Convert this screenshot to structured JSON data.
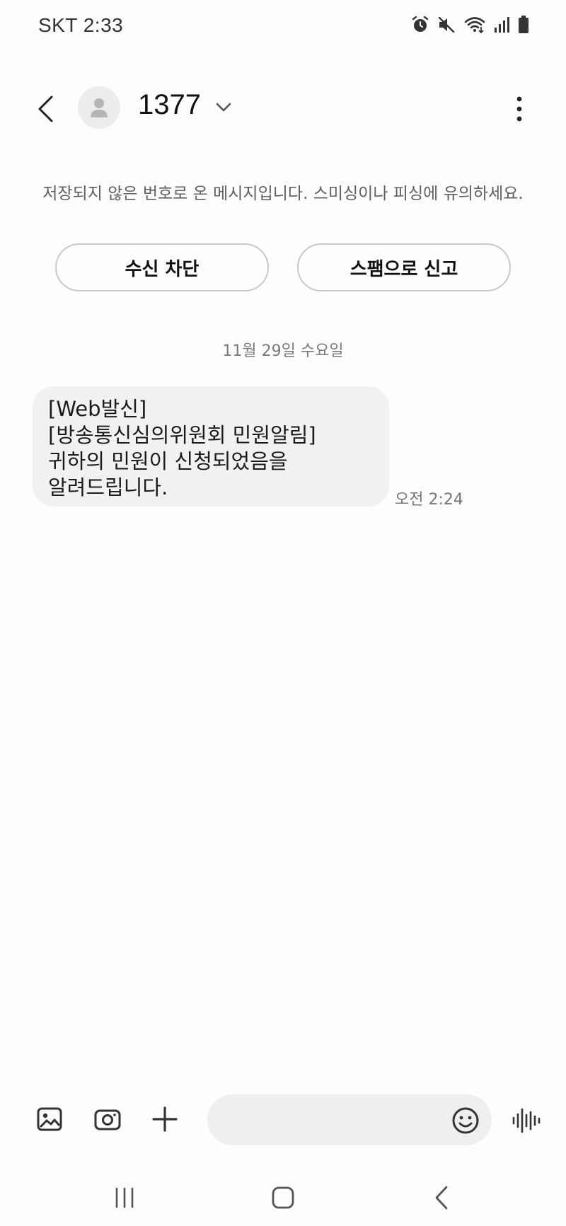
{
  "status_bar": {
    "carrier_time": "SKT 2:33",
    "icons": [
      "alarm-icon",
      "mute-icon",
      "wifi-icon",
      "signal-icon",
      "battery-icon"
    ]
  },
  "header": {
    "contact": "1377",
    "back_icon": "back-arrow-icon",
    "avatar_icon": "person-icon",
    "dropdown_icon": "chevron-down-icon",
    "menu_icon": "more-vertical-icon"
  },
  "warning": {
    "text": "저장되지 않은 번호로 온 메시지입니다. 스미싱이나 피싱에 유의하세요.",
    "block_label": "수신 차단",
    "spam_label": "스팸으로 신고"
  },
  "conversation": {
    "date": "11월 29일 수요일",
    "messages": [
      {
        "lines": [
          "[Web발신]",
          "[방송통신심의위원회 민원알림]",
          "귀하의 민원이 신청되었음을",
          "알려드립니다."
        ],
        "time": "오전 2:24"
      }
    ]
  },
  "composer": {
    "gallery_icon": "gallery-icon",
    "camera_icon": "camera-icon",
    "add_icon": "plus-icon",
    "emoji_icon": "emoji-icon",
    "voice_icon": "voice-wave-icon",
    "placeholder": ""
  },
  "nav_bar": {
    "recents_icon": "recents-icon",
    "home_icon": "home-icon",
    "back_icon": "nav-back-icon"
  },
  "colors": {
    "background": "#fdfdfd",
    "bubble": "#f1f1f1",
    "pill_border": "#c8c8c8",
    "input_bg": "#efefef"
  }
}
